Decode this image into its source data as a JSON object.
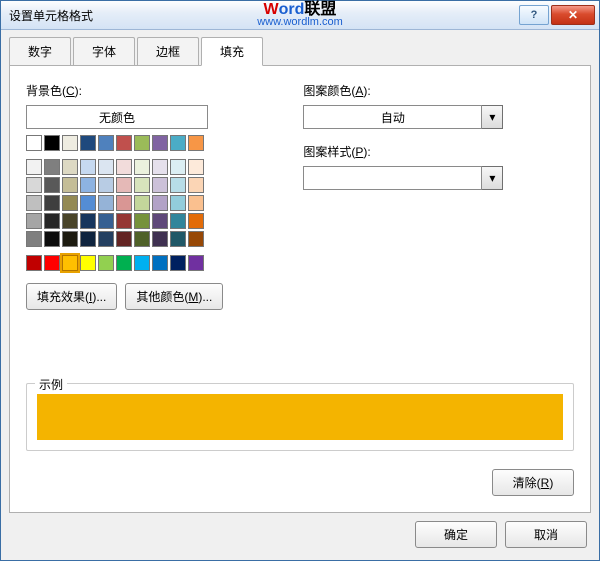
{
  "window": {
    "title": "设置单元格格式"
  },
  "watermark": {
    "line1_a": "W",
    "line1_b": "ord",
    "line1_c": "联盟",
    "line2": "www.wordlm.com"
  },
  "winbtns": {
    "help": "?",
    "close": "✕"
  },
  "tabs": [
    "数字",
    "字体",
    "边框",
    "填充"
  ],
  "active_tab": 3,
  "fill": {
    "bgcolor_label_pre": "背景色(",
    "bgcolor_label_u": "C",
    "bgcolor_label_post": "):",
    "no_color": "无颜色",
    "theme_row": [
      "#ffffff",
      "#000000",
      "#eeece1",
      "#1f497d",
      "#4f81bd",
      "#c0504d",
      "#9bbb59",
      "#8064a2",
      "#4bacc6",
      "#f79646"
    ],
    "theme_tints": [
      [
        "#f2f2f2",
        "#7f7f7f",
        "#ddd9c3",
        "#c6d9f0",
        "#dbe5f1",
        "#f2dcdb",
        "#ebf1dd",
        "#e5e0ec",
        "#dbeef3",
        "#fdeada"
      ],
      [
        "#d8d8d8",
        "#595959",
        "#c4bd97",
        "#8db3e2",
        "#b8cce4",
        "#e5b9b7",
        "#d7e3bc",
        "#ccc1d9",
        "#b7dde8",
        "#fbd5b5"
      ],
      [
        "#bfbfbf",
        "#3f3f3f",
        "#938953",
        "#548dd4",
        "#95b3d7",
        "#d99694",
        "#c3d69b",
        "#b2a2c7",
        "#92cddc",
        "#fac08f"
      ],
      [
        "#a5a5a5",
        "#262626",
        "#494429",
        "#17365d",
        "#366092",
        "#953734",
        "#76923c",
        "#5f497a",
        "#31859b",
        "#e36c09"
      ],
      [
        "#7f7f7f",
        "#0c0c0c",
        "#1d1b10",
        "#0f243e",
        "#244061",
        "#632423",
        "#4f6128",
        "#3f3151",
        "#205867",
        "#974806"
      ]
    ],
    "standard": [
      "#c00000",
      "#ff0000",
      "#ffc000",
      "#ffff00",
      "#92d050",
      "#00b050",
      "#00b0f0",
      "#0070c0",
      "#002060",
      "#7030a0"
    ],
    "selected_color": "#ffc000",
    "fill_effects_label": "填充效果(",
    "fill_effects_u": "I",
    "fill_effects_post": ")...",
    "more_colors_label": "其他颜色(",
    "more_colors_u": "M",
    "more_colors_post": ")...",
    "pattern_color_label_pre": "图案颜色(",
    "pattern_color_u": "A",
    "pattern_color_post": "):",
    "pattern_color_value": "自动",
    "pattern_style_label_pre": "图案样式(",
    "pattern_style_u": "P",
    "pattern_style_post": "):",
    "pattern_style_value": "",
    "sample_label": "示例",
    "sample_color": "#f4b400",
    "clear_label_pre": "清除(",
    "clear_u": "R",
    "clear_post": ")"
  },
  "buttons": {
    "ok": "确定",
    "cancel": "取消"
  }
}
